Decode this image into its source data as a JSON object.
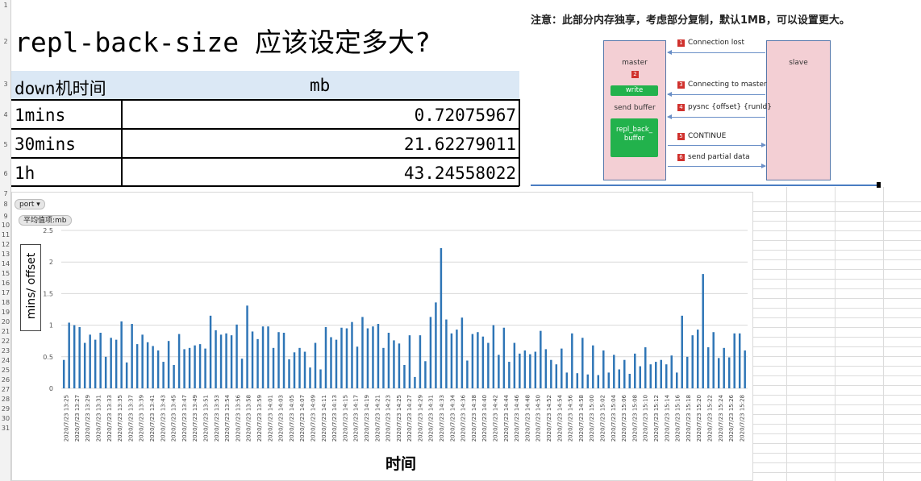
{
  "row_numbers": [
    "1",
    "2",
    "3",
    "4",
    "5",
    "6",
    "7",
    "8",
    "9",
    "10",
    "11",
    "12",
    "13",
    "14",
    "15",
    "16",
    "17",
    "18",
    "19",
    "20",
    "21",
    "22",
    "23",
    "24",
    "25",
    "26",
    "27",
    "28",
    "29",
    "30",
    "31"
  ],
  "sheet": {
    "title": "repl-back-size 应该设定多大?",
    "headers": {
      "col1": "down机时间",
      "col2": "mb"
    },
    "rows": [
      {
        "time": "1mins",
        "mb": "0.72075967"
      },
      {
        "time": "30mins",
        "mb": "21.62279011"
      },
      {
        "time": "1h",
        "mb": "43.24558022"
      }
    ]
  },
  "diagram": {
    "note": "注意：此部分内存独享，考虑部分复制，默认1MB，可以设置更大。",
    "master_label": "master",
    "slave_label": "slave",
    "write_label": "write",
    "send_buffer_label": "send buffer",
    "repl_back_buffer_label": "repl_back_ buffer",
    "steps": [
      {
        "num": "1",
        "label": "Connection lost"
      },
      {
        "num": "2",
        "label": ""
      },
      {
        "num": "3",
        "label": "Connecting to master"
      },
      {
        "num": "4",
        "label": "pysnc {offset} {runId}"
      },
      {
        "num": "5",
        "label": "CONTINUE"
      },
      {
        "num": "6",
        "label": "send partial data"
      }
    ],
    "colors": {
      "node_fill": "#f3cfd4",
      "green": "#22b24c",
      "badge": "#d0312d",
      "arrow": "#6a8fc7"
    }
  },
  "chart_controls": {
    "filter_pill": "port ▾",
    "series_pill": "平均值项:mb"
  },
  "chart_data": {
    "type": "bar",
    "xlabel": "时间",
    "ylabel": "mins/ offset",
    "ylim": [
      0,
      2.5
    ],
    "yticks": [
      "0",
      "0.5",
      "1",
      "1.5",
      "2",
      "2.5"
    ],
    "grid": true,
    "bar_color": "#2e75b6",
    "tick_labels": [
      "2020/7/23 13:25",
      "2020/7/23 13:27",
      "2020/7/23 13:29",
      "2020/7/23 13:31",
      "2020/7/23 13:33",
      "2020/7/23 13:35",
      "2020/7/23 13:37",
      "2020/7/23 13:39",
      "2020/7/23 13:41",
      "2020/7/23 13:43",
      "2020/7/23 13:45",
      "2020/7/23 13:47",
      "2020/7/23 13:49",
      "2020/7/23 13:51",
      "2020/7/23 13:53",
      "2020/7/23 13:54",
      "2020/7/23 13:56",
      "2020/7/23 13:58",
      "2020/7/23 13:59",
      "2020/7/23 14:01",
      "2020/7/23 14:03",
      "2020/7/23 14:05",
      "2020/7/23 14:07",
      "2020/7/23 14:09",
      "2020/7/23 14:11",
      "2020/7/23 14:13",
      "2020/7/23 14:15",
      "2020/7/23 14:17",
      "2020/7/23 14:19",
      "2020/7/23 14:21",
      "2020/7/23 14:23",
      "2020/7/23 14:25",
      "2020/7/23 14:27",
      "2020/7/23 14:29",
      "2020/7/23 14:31",
      "2020/7/23 14:33",
      "2020/7/23 14:34",
      "2020/7/23 14:36",
      "2020/7/23 14:38",
      "2020/7/23 14:40",
      "2020/7/23 14:42",
      "2020/7/23 14:44",
      "2020/7/23 14:46",
      "2020/7/23 14:48",
      "2020/7/23 14:50",
      "2020/7/23 14:52",
      "2020/7/23 14:54",
      "2020/7/23 14:56",
      "2020/7/23 14:58",
      "2020/7/23 15:00",
      "2020/7/23 15:02",
      "2020/7/23 15:04",
      "2020/7/23 15:06",
      "2020/7/23 15:08",
      "2020/7/23 15:10",
      "2020/7/23 15:12",
      "2020/7/23 15:14",
      "2020/7/23 15:16",
      "2020/7/23 15:18",
      "2020/7/23 15:20",
      "2020/7/23 15:22",
      "2020/7/23 15:24",
      "2020/7/23 15:26",
      "2020/7/23 15:28"
    ],
    "values": [
      0.45,
      1.04,
      1.0,
      0.97,
      0.72,
      0.85,
      0.77,
      0.88,
      0.5,
      0.8,
      0.77,
      1.06,
      0.41,
      1.02,
      0.7,
      0.85,
      0.73,
      0.67,
      0.6,
      0.42,
      0.75,
      0.37,
      0.86,
      0.62,
      0.64,
      0.68,
      0.7,
      0.63,
      1.15,
      0.92,
      0.85,
      0.87,
      0.84,
      1.01,
      0.47,
      1.31,
      0.9,
      0.78,
      0.98,
      0.98,
      0.64,
      0.89,
      0.88,
      0.46,
      0.57,
      0.64,
      0.58,
      0.33,
      0.72,
      0.3,
      0.97,
      0.81,
      0.77,
      0.96,
      0.95,
      1.05,
      0.66,
      1.13,
      0.95,
      0.98,
      1.02,
      0.64,
      0.88,
      0.76,
      0.71,
      0.37,
      0.84,
      0.18,
      0.84,
      0.43,
      1.13,
      1.36,
      2.22,
      1.09,
      0.87,
      0.93,
      1.12,
      0.44,
      0.86,
      0.89,
      0.82,
      0.72,
      1.0,
      0.53,
      0.96,
      0.42,
      0.72,
      0.55,
      0.6,
      0.54,
      0.58,
      0.91,
      0.62,
      0.45,
      0.38,
      0.63,
      0.25,
      0.87,
      0.24,
      0.8,
      0.22,
      0.68,
      0.21,
      0.6,
      0.25,
      0.53,
      0.3,
      0.45,
      0.23,
      0.55,
      0.35,
      0.65,
      0.38,
      0.42,
      0.45,
      0.38,
      0.52,
      0.25,
      1.15,
      0.5,
      0.84,
      0.93,
      1.81,
      0.65,
      0.89,
      0.48,
      0.64,
      0.49,
      0.87,
      0.87,
      0.6
    ]
  }
}
